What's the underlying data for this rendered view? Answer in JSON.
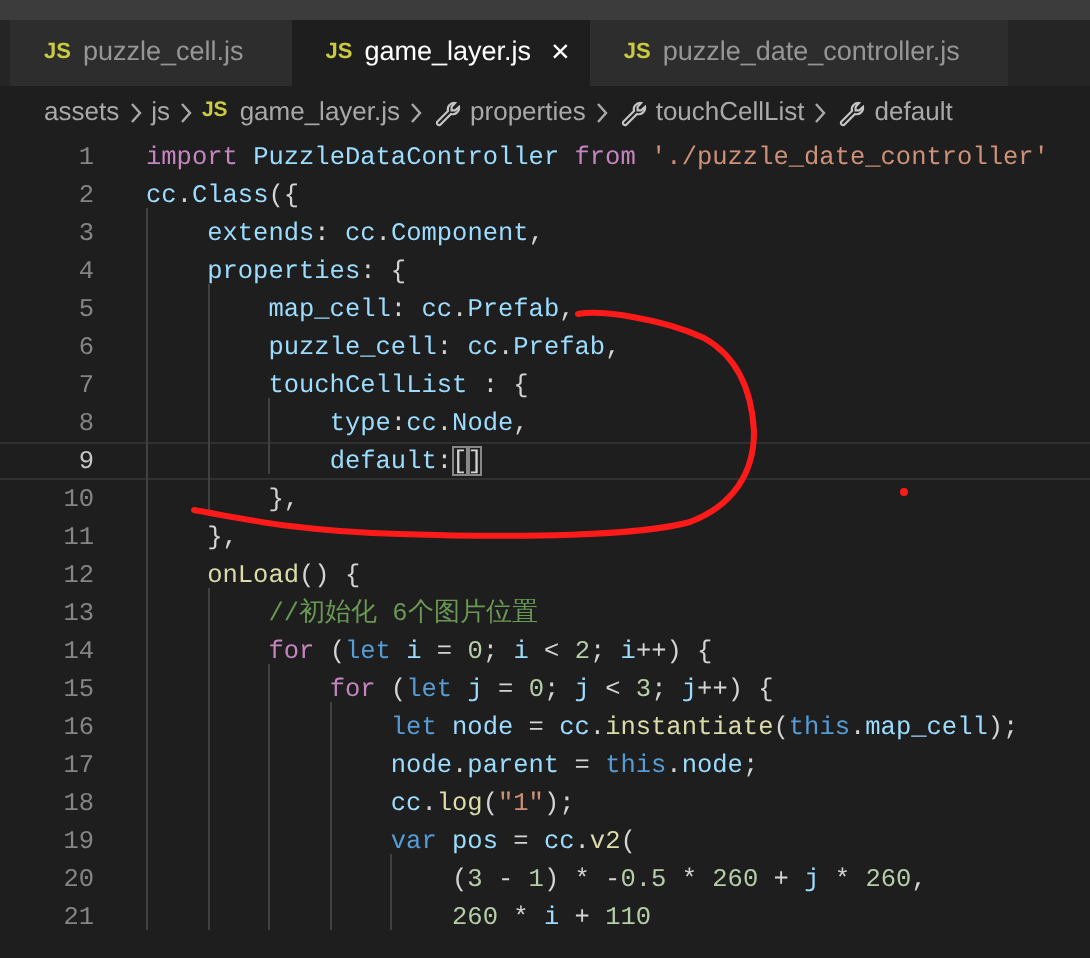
{
  "tabs": [
    {
      "badge": "JS",
      "label": "puzzle_cell.js",
      "selected": false
    },
    {
      "badge": "JS",
      "label": "game_layer.js",
      "selected": true,
      "close": "×"
    },
    {
      "badge": "JS",
      "label": "puzzle_date_controller.js",
      "selected": false
    }
  ],
  "breadcrumb": [
    {
      "kind": "folder",
      "label": "assets"
    },
    {
      "kind": "folder",
      "label": "js"
    },
    {
      "kind": "file",
      "badge": "JS",
      "label": "game_layer.js"
    },
    {
      "kind": "property",
      "label": "properties"
    },
    {
      "kind": "property",
      "label": "touchCellList"
    },
    {
      "kind": "property",
      "label": "default"
    }
  ],
  "editor": {
    "lines": [
      {
        "number": "1",
        "current": false,
        "tokens": [
          {
            "kind": "keyword",
            "text": "import"
          },
          {
            "kind": "variable",
            "text": " PuzzleDataController "
          },
          {
            "kind": "keyword",
            "text": "from "
          },
          {
            "kind": "string",
            "text": "'./puzzle_date_controller'"
          }
        ]
      },
      {
        "number": "2",
        "current": false,
        "tokens": [
          {
            "kind": "variable",
            "text": "cc"
          },
          {
            "kind": "plain",
            "text": "."
          },
          {
            "kind": "variable",
            "text": "Class"
          },
          {
            "kind": "plain",
            "text": "({"
          }
        ]
      },
      {
        "number": "3",
        "current": false,
        "tokens": [
          {
            "kind": "variable",
            "text": "    extends"
          },
          {
            "kind": "plain",
            "text": ": "
          },
          {
            "kind": "variable",
            "text": "cc"
          },
          {
            "kind": "plain",
            "text": "."
          },
          {
            "kind": "variable",
            "text": "Component"
          },
          {
            "kind": "plain",
            "text": ","
          }
        ]
      },
      {
        "number": "4",
        "current": false,
        "tokens": [
          {
            "kind": "variable",
            "text": "    properties"
          },
          {
            "kind": "plain",
            "text": ": {"
          }
        ]
      },
      {
        "number": "5",
        "current": false,
        "tokens": [
          {
            "kind": "variable",
            "text": "        map_cell"
          },
          {
            "kind": "plain",
            "text": ": "
          },
          {
            "kind": "variable",
            "text": "cc"
          },
          {
            "kind": "plain",
            "text": "."
          },
          {
            "kind": "variable",
            "text": "Prefab"
          },
          {
            "kind": "plain",
            "text": ","
          }
        ]
      },
      {
        "number": "6",
        "current": false,
        "tokens": [
          {
            "kind": "variable",
            "text": "        puzzle_cell"
          },
          {
            "kind": "plain",
            "text": ": "
          },
          {
            "kind": "variable",
            "text": "cc"
          },
          {
            "kind": "plain",
            "text": "."
          },
          {
            "kind": "variable",
            "text": "Prefab"
          },
          {
            "kind": "plain",
            "text": ","
          }
        ]
      },
      {
        "number": "7",
        "current": false,
        "tokens": [
          {
            "kind": "variable",
            "text": "        touchCellList"
          },
          {
            "kind": "plain",
            "text": " : {"
          }
        ]
      },
      {
        "number": "8",
        "current": false,
        "tokens": [
          {
            "kind": "variable",
            "text": "            type"
          },
          {
            "kind": "plain",
            "text": ":"
          },
          {
            "kind": "variable",
            "text": "cc"
          },
          {
            "kind": "plain",
            "text": "."
          },
          {
            "kind": "variable",
            "text": "Node"
          },
          {
            "kind": "plain",
            "text": ","
          }
        ]
      },
      {
        "number": "9",
        "current": true,
        "tokens": [
          {
            "kind": "variable",
            "text": "            default"
          },
          {
            "kind": "plain",
            "text": ":"
          },
          {
            "kind": "bracket_match",
            "text": "["
          },
          {
            "kind": "bracket_match",
            "text": "]"
          }
        ]
      },
      {
        "number": "10",
        "current": false,
        "tokens": [
          {
            "kind": "plain",
            "text": "        },"
          }
        ]
      },
      {
        "number": "11",
        "current": false,
        "tokens": [
          {
            "kind": "plain",
            "text": "    },"
          }
        ]
      },
      {
        "number": "12",
        "current": false,
        "tokens": [
          {
            "kind": "function",
            "text": "    onLoad"
          },
          {
            "kind": "plain",
            "text": "() {"
          }
        ]
      },
      {
        "number": "13",
        "current": false,
        "tokens": [
          {
            "kind": "comment",
            "text": "        //初始化 6个图片位置"
          }
        ]
      },
      {
        "number": "14",
        "current": false,
        "tokens": [
          {
            "kind": "keyword",
            "text": "        for"
          },
          {
            "kind": "plain",
            "text": " ("
          },
          {
            "kind": "storage",
            "text": "let "
          },
          {
            "kind": "variable",
            "text": "i"
          },
          {
            "kind": "plain",
            "text": " = "
          },
          {
            "kind": "number",
            "text": "0"
          },
          {
            "kind": "plain",
            "text": "; "
          },
          {
            "kind": "variable",
            "text": "i"
          },
          {
            "kind": "plain",
            "text": " < "
          },
          {
            "kind": "number",
            "text": "2"
          },
          {
            "kind": "plain",
            "text": "; "
          },
          {
            "kind": "variable",
            "text": "i"
          },
          {
            "kind": "plain",
            "text": "++) {"
          }
        ]
      },
      {
        "number": "15",
        "current": false,
        "tokens": [
          {
            "kind": "keyword",
            "text": "            for"
          },
          {
            "kind": "plain",
            "text": " ("
          },
          {
            "kind": "storage",
            "text": "let "
          },
          {
            "kind": "variable",
            "text": "j"
          },
          {
            "kind": "plain",
            "text": " = "
          },
          {
            "kind": "number",
            "text": "0"
          },
          {
            "kind": "plain",
            "text": "; "
          },
          {
            "kind": "variable",
            "text": "j"
          },
          {
            "kind": "plain",
            "text": " < "
          },
          {
            "kind": "number",
            "text": "3"
          },
          {
            "kind": "plain",
            "text": "; "
          },
          {
            "kind": "variable",
            "text": "j"
          },
          {
            "kind": "plain",
            "text": "++) {"
          }
        ]
      },
      {
        "number": "16",
        "current": false,
        "tokens": [
          {
            "kind": "storage",
            "text": "                let "
          },
          {
            "kind": "variable",
            "text": "node"
          },
          {
            "kind": "plain",
            "text": " = "
          },
          {
            "kind": "variable",
            "text": "cc"
          },
          {
            "kind": "plain",
            "text": "."
          },
          {
            "kind": "function",
            "text": "instantiate"
          },
          {
            "kind": "plain",
            "text": "("
          },
          {
            "kind": "storage",
            "text": "this"
          },
          {
            "kind": "plain",
            "text": "."
          },
          {
            "kind": "variable",
            "text": "map_cell"
          },
          {
            "kind": "plain",
            "text": ");"
          }
        ]
      },
      {
        "number": "17",
        "current": false,
        "tokens": [
          {
            "kind": "variable",
            "text": "                node"
          },
          {
            "kind": "plain",
            "text": "."
          },
          {
            "kind": "variable",
            "text": "parent"
          },
          {
            "kind": "plain",
            "text": " = "
          },
          {
            "kind": "storage",
            "text": "this"
          },
          {
            "kind": "plain",
            "text": "."
          },
          {
            "kind": "variable",
            "text": "node"
          },
          {
            "kind": "plain",
            "text": ";"
          }
        ]
      },
      {
        "number": "18",
        "current": false,
        "tokens": [
          {
            "kind": "variable",
            "text": "                cc"
          },
          {
            "kind": "plain",
            "text": "."
          },
          {
            "kind": "function",
            "text": "log"
          },
          {
            "kind": "plain",
            "text": "("
          },
          {
            "kind": "string",
            "text": "\"1\""
          },
          {
            "kind": "plain",
            "text": ");"
          }
        ]
      },
      {
        "number": "19",
        "current": false,
        "tokens": [
          {
            "kind": "storage",
            "text": "                var "
          },
          {
            "kind": "variable",
            "text": "pos"
          },
          {
            "kind": "plain",
            "text": " = "
          },
          {
            "kind": "variable",
            "text": "cc"
          },
          {
            "kind": "plain",
            "text": "."
          },
          {
            "kind": "function",
            "text": "v2"
          },
          {
            "kind": "plain",
            "text": "("
          }
        ]
      },
      {
        "number": "20",
        "current": false,
        "tokens": [
          {
            "kind": "plain",
            "text": "                    ("
          },
          {
            "kind": "number",
            "text": "3"
          },
          {
            "kind": "plain",
            "text": " - "
          },
          {
            "kind": "number",
            "text": "1"
          },
          {
            "kind": "plain",
            "text": ") * -"
          },
          {
            "kind": "number",
            "text": "0.5"
          },
          {
            "kind": "plain",
            "text": " * "
          },
          {
            "kind": "number",
            "text": "260"
          },
          {
            "kind": "plain",
            "text": " + "
          },
          {
            "kind": "variable",
            "text": "j"
          },
          {
            "kind": "plain",
            "text": " * "
          },
          {
            "kind": "number",
            "text": "260"
          },
          {
            "kind": "plain",
            "text": ","
          }
        ]
      },
      {
        "number": "21",
        "current": false,
        "tokens": [
          {
            "kind": "number",
            "text": "                    260"
          },
          {
            "kind": "plain",
            "text": " * "
          },
          {
            "kind": "variable",
            "text": "i"
          },
          {
            "kind": "plain",
            "text": " + "
          },
          {
            "kind": "number",
            "text": "110"
          }
        ]
      }
    ]
  }
}
